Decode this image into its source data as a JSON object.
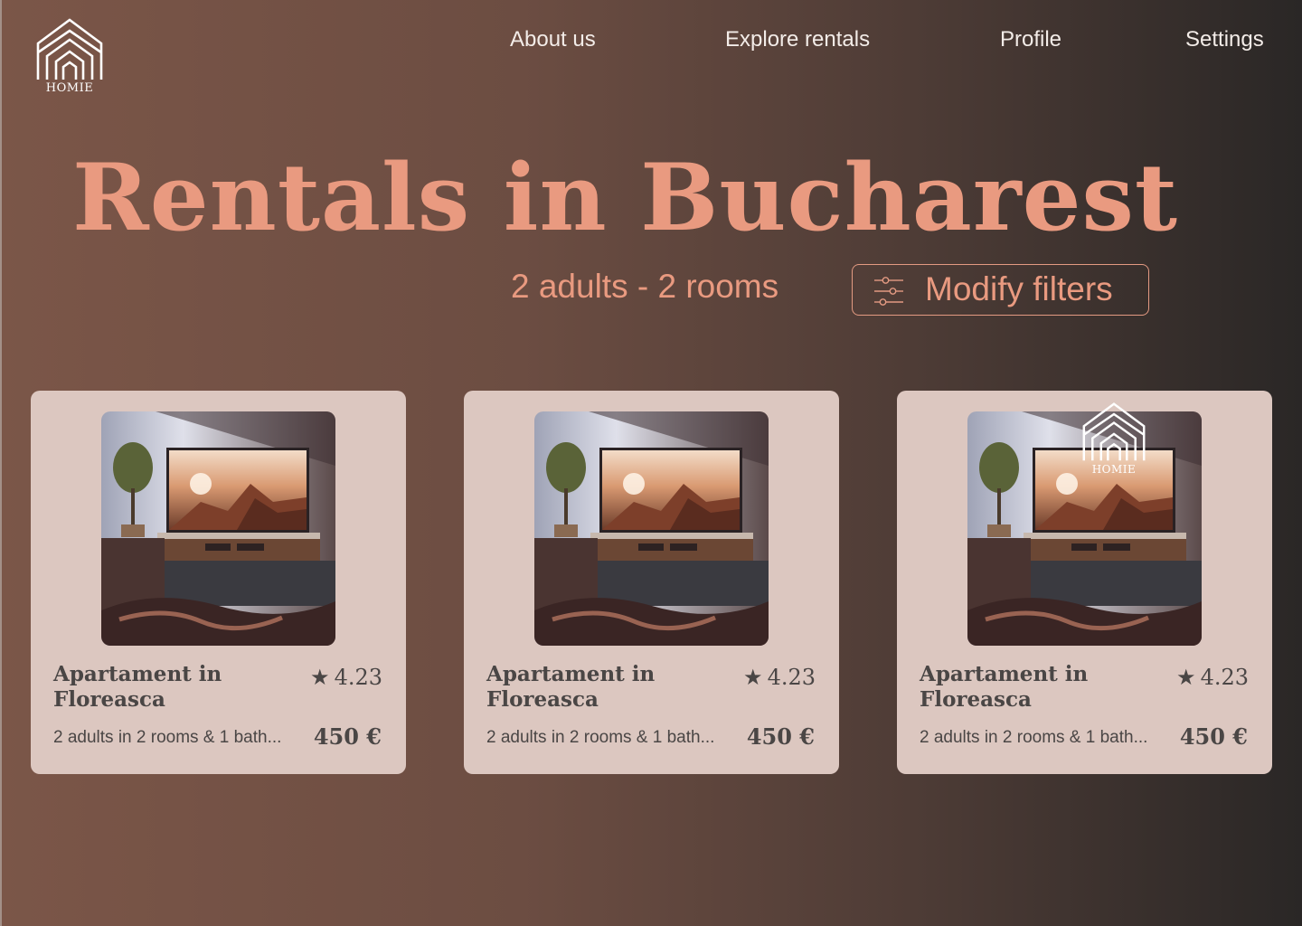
{
  "brand": {
    "name": "HOMIE"
  },
  "nav": {
    "items": [
      {
        "label": "About us"
      },
      {
        "label": "Explore rentals"
      },
      {
        "label": "Profile"
      },
      {
        "label": "Settings"
      }
    ]
  },
  "hero": {
    "title": "Rentals in Bucharest",
    "guests": "2 adults - 2 rooms",
    "filters_button": "Modify filters"
  },
  "listings": [
    {
      "title": "Apartament in Floreasca",
      "rating": "4.23",
      "description": "2 adults in 2 rooms & 1 bath...",
      "price": "450 €"
    },
    {
      "title": "Apartament in Floreasca",
      "rating": "4.23",
      "description": "2 adults in 2 rooms & 1 bath...",
      "price": "450 €"
    },
    {
      "title": "Apartament in Floreasca",
      "rating": "4.23",
      "description": "2 adults in 2 rooms & 1 bath...",
      "price": "450 €"
    }
  ],
  "colors": {
    "accent": "#e99a80",
    "card": "#dcc7c0",
    "card_text": "#4a4645"
  },
  "icons": {
    "logo": "house-logo-icon",
    "filters": "sliders-icon",
    "rating": "star-icon"
  }
}
